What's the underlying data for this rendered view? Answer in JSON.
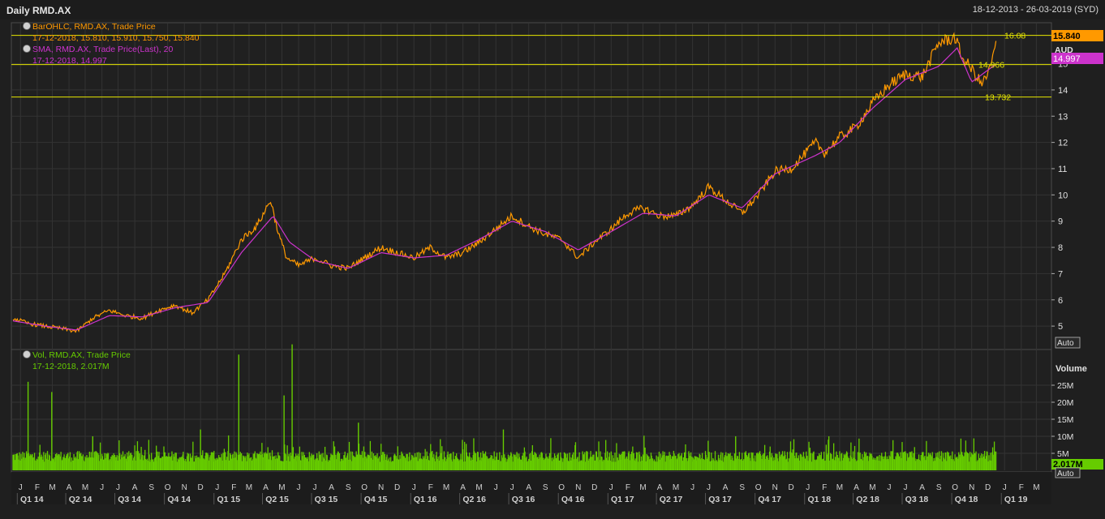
{
  "header": {
    "title": "Daily RMD.AX",
    "range": "18-12-2013 - 26-03-2019 (SYD)"
  },
  "legend": {
    "ohlc_label": "BarOHLC, RMD.AX, Trade Price",
    "ohlc_values": "17-12-2018, 15.810, 15.910, 15.750, 15.840",
    "sma_label": "SMA, RMD.AX, Trade Price(Last), 20",
    "sma_values": "17-12-2018, 14.997",
    "vol_label": "Vol, RMD.AX, Trade Price",
    "vol_values": "17-12-2018, 2.017M"
  },
  "price_axis": {
    "currency": "AUD",
    "auto": "Auto",
    "last_price": "15.840",
    "last_sma": "14.997"
  },
  "volume_axis": {
    "title": "Volume",
    "auto": "Auto",
    "last_volume": "2.017M"
  },
  "hlines": [
    {
      "value": 16.08,
      "label": "16.08"
    },
    {
      "value": 14.966,
      "label": "14.966"
    },
    {
      "value": 13.732,
      "label": "13.732"
    }
  ],
  "colors": {
    "price": "#ff9900",
    "sma": "#cc33cc",
    "volume": "#66cc00",
    "hline": "#e6e600",
    "grid": "#333333"
  },
  "chart_data": [
    {
      "type": "line",
      "ylim": [
        4.2,
        16.5
      ],
      "yticks": [
        5,
        6,
        7,
        8,
        9,
        10,
        11,
        12,
        13,
        14,
        15
      ],
      "series": [
        {
          "name": "BarOHLC, RMD.AX, Trade Price",
          "x": [
            "2013-12-18",
            "2014-01-15",
            "2014-02-15",
            "2014-03-20",
            "2014-04-15",
            "2014-05-15",
            "2014-06-15",
            "2014-07-15",
            "2014-08-15",
            "2014-09-15",
            "2014-10-15",
            "2014-11-15",
            "2014-12-15",
            "2015-01-15",
            "2015-02-15",
            "2015-03-15",
            "2015-04-10",
            "2015-04-25",
            "2015-05-10",
            "2015-06-01",
            "2015-07-01",
            "2015-08-01",
            "2015-09-01",
            "2015-10-01",
            "2015-11-01",
            "2015-12-01",
            "2016-01-01",
            "2016-02-01",
            "2016-03-01",
            "2016-04-01",
            "2016-05-01",
            "2016-06-01",
            "2016-07-01",
            "2016-08-01",
            "2016-09-01",
            "2016-10-01",
            "2016-11-01",
            "2016-12-01",
            "2017-01-01",
            "2017-02-01",
            "2017-03-01",
            "2017-04-01",
            "2017-05-01",
            "2017-06-01",
            "2017-07-01",
            "2017-08-01",
            "2017-09-01",
            "2017-10-01",
            "2017-11-01",
            "2017-12-01",
            "2018-01-15",
            "2018-02-01",
            "2018-03-01",
            "2018-04-01",
            "2018-05-01",
            "2018-06-01",
            "2018-07-01",
            "2018-08-01",
            "2018-09-01",
            "2018-10-01",
            "2018-10-15",
            "2018-11-01",
            "2018-11-20",
            "2018-12-05",
            "2018-12-17"
          ],
          "values": [
            5.3,
            5.1,
            5.0,
            4.9,
            4.8,
            5.3,
            5.6,
            5.4,
            5.3,
            5.6,
            5.8,
            5.5,
            6.0,
            7.0,
            8.3,
            8.8,
            9.8,
            8.5,
            7.6,
            7.3,
            7.6,
            7.3,
            7.2,
            7.6,
            8.0,
            7.8,
            7.6,
            8.0,
            7.6,
            7.8,
            8.2,
            8.7,
            9.2,
            8.8,
            8.5,
            8.3,
            7.6,
            8.2,
            8.7,
            9.3,
            9.5,
            9.2,
            9.2,
            9.6,
            10.3,
            9.8,
            9.3,
            10.0,
            10.9,
            11.0,
            12.0,
            11.6,
            12.2,
            12.6,
            13.5,
            14.2,
            14.6,
            14.5,
            15.8,
            16.0,
            15.2,
            14.8,
            14.2,
            14.8,
            15.84
          ]
        },
        {
          "name": "SMA, RMD.AX, Trade Price(Last), 20",
          "x": [
            "2013-12-18",
            "2014-02-15",
            "2014-04-15",
            "2014-06-15",
            "2014-08-15",
            "2014-10-15",
            "2014-12-15",
            "2015-02-15",
            "2015-04-15",
            "2015-05-15",
            "2015-07-01",
            "2015-09-01",
            "2015-11-01",
            "2016-01-01",
            "2016-03-01",
            "2016-05-01",
            "2016-07-01",
            "2016-09-01",
            "2016-11-01",
            "2017-01-01",
            "2017-03-01",
            "2017-05-01",
            "2017-07-01",
            "2017-09-01",
            "2017-11-01",
            "2018-01-15",
            "2018-03-01",
            "2018-05-01",
            "2018-07-01",
            "2018-09-01",
            "2018-10-05",
            "2018-11-01",
            "2018-12-17"
          ],
          "values": [
            5.2,
            5.0,
            4.85,
            5.4,
            5.35,
            5.7,
            5.9,
            7.8,
            9.2,
            8.2,
            7.5,
            7.2,
            7.8,
            7.6,
            7.7,
            8.3,
            9.0,
            8.6,
            7.9,
            8.6,
            9.3,
            9.2,
            10.0,
            9.5,
            10.8,
            11.5,
            12.0,
            13.3,
            14.4,
            14.9,
            15.6,
            14.3,
            14.997
          ]
        }
      ]
    },
    {
      "type": "bar",
      "ylim": [
        0,
        35
      ],
      "yticks": [
        5,
        10,
        15,
        20,
        25
      ],
      "ytick_labels": [
        "5M",
        "10M",
        "15M",
        "20M",
        "25M"
      ],
      "spikes": [
        {
          "x": "2014-01-15",
          "value": 26
        },
        {
          "x": "2014-02-28",
          "value": 23
        },
        {
          "x": "2014-05-15",
          "value": 10
        },
        {
          "x": "2014-12-01",
          "value": 12
        },
        {
          "x": "2015-02-10",
          "value": 34
        },
        {
          "x": "2015-05-20",
          "value": 37
        },
        {
          "x": "2015-05-05",
          "value": 22
        },
        {
          "x": "2015-09-20",
          "value": 14
        },
        {
          "x": "2016-06-15",
          "value": 12
        },
        {
          "x": "2017-08-20",
          "value": 10
        },
        {
          "x": "2018-02-08",
          "value": 9
        }
      ],
      "last": {
        "x": "2018-12-17",
        "value": 2.017
      }
    }
  ],
  "time_axis": {
    "months": [
      {
        "x": "2014-01-01",
        "label": "J"
      },
      {
        "x": "2014-02-01",
        "label": "F"
      },
      {
        "x": "2014-03-01",
        "label": "M"
      },
      {
        "x": "2014-04-01",
        "label": "A"
      },
      {
        "x": "2014-05-01",
        "label": "M"
      },
      {
        "x": "2014-06-01",
        "label": "J"
      },
      {
        "x": "2014-07-01",
        "label": "J"
      },
      {
        "x": "2014-08-01",
        "label": "A"
      },
      {
        "x": "2014-09-01",
        "label": "S"
      },
      {
        "x": "2014-10-01",
        "label": "O"
      },
      {
        "x": "2014-11-01",
        "label": "N"
      },
      {
        "x": "2014-12-01",
        "label": "D"
      },
      {
        "x": "2015-01-01",
        "label": "J"
      },
      {
        "x": "2015-02-01",
        "label": "F"
      },
      {
        "x": "2015-03-01",
        "label": "M"
      },
      {
        "x": "2015-04-01",
        "label": "A"
      },
      {
        "x": "2015-05-01",
        "label": "M"
      },
      {
        "x": "2015-06-01",
        "label": "J"
      },
      {
        "x": "2015-07-01",
        "label": "J"
      },
      {
        "x": "2015-08-01",
        "label": "A"
      },
      {
        "x": "2015-09-01",
        "label": "S"
      },
      {
        "x": "2015-10-01",
        "label": "O"
      },
      {
        "x": "2015-11-01",
        "label": "N"
      },
      {
        "x": "2015-12-01",
        "label": "D"
      },
      {
        "x": "2016-01-01",
        "label": "J"
      },
      {
        "x": "2016-02-01",
        "label": "F"
      },
      {
        "x": "2016-03-01",
        "label": "M"
      },
      {
        "x": "2016-04-01",
        "label": "A"
      },
      {
        "x": "2016-05-01",
        "label": "M"
      },
      {
        "x": "2016-06-01",
        "label": "J"
      },
      {
        "x": "2016-07-01",
        "label": "J"
      },
      {
        "x": "2016-08-01",
        "label": "A"
      },
      {
        "x": "2016-09-01",
        "label": "S"
      },
      {
        "x": "2016-10-01",
        "label": "O"
      },
      {
        "x": "2016-11-01",
        "label": "N"
      },
      {
        "x": "2016-12-01",
        "label": "D"
      },
      {
        "x": "2017-01-01",
        "label": "J"
      },
      {
        "x": "2017-02-01",
        "label": "F"
      },
      {
        "x": "2017-03-01",
        "label": "M"
      },
      {
        "x": "2017-04-01",
        "label": "A"
      },
      {
        "x": "2017-05-01",
        "label": "M"
      },
      {
        "x": "2017-06-01",
        "label": "J"
      },
      {
        "x": "2017-07-01",
        "label": "J"
      },
      {
        "x": "2017-08-01",
        "label": "A"
      },
      {
        "x": "2017-09-01",
        "label": "S"
      },
      {
        "x": "2017-10-01",
        "label": "O"
      },
      {
        "x": "2017-11-01",
        "label": "N"
      },
      {
        "x": "2017-12-01",
        "label": "D"
      },
      {
        "x": "2018-01-01",
        "label": "J"
      },
      {
        "x": "2018-02-01",
        "label": "F"
      },
      {
        "x": "2018-03-01",
        "label": "M"
      },
      {
        "x": "2018-04-01",
        "label": "A"
      },
      {
        "x": "2018-05-01",
        "label": "M"
      },
      {
        "x": "2018-06-01",
        "label": "J"
      },
      {
        "x": "2018-07-01",
        "label": "J"
      },
      {
        "x": "2018-08-01",
        "label": "A"
      },
      {
        "x": "2018-09-01",
        "label": "S"
      },
      {
        "x": "2018-10-01",
        "label": "O"
      },
      {
        "x": "2018-11-01",
        "label": "N"
      },
      {
        "x": "2018-12-01",
        "label": "D"
      },
      {
        "x": "2019-01-01",
        "label": "J"
      },
      {
        "x": "2019-02-01",
        "label": "F"
      },
      {
        "x": "2019-03-01",
        "label": "M"
      }
    ],
    "quarters": [
      {
        "x": "2014-01-01",
        "label": "Q1 14"
      },
      {
        "x": "2014-04-01",
        "label": "Q2 14"
      },
      {
        "x": "2014-07-01",
        "label": "Q3 14"
      },
      {
        "x": "2014-10-01",
        "label": "Q4 14"
      },
      {
        "x": "2015-01-01",
        "label": "Q1 15"
      },
      {
        "x": "2015-04-01",
        "label": "Q2 15"
      },
      {
        "x": "2015-07-01",
        "label": "Q3 15"
      },
      {
        "x": "2015-10-01",
        "label": "Q4 15"
      },
      {
        "x": "2016-01-01",
        "label": "Q1 16"
      },
      {
        "x": "2016-04-01",
        "label": "Q2 16"
      },
      {
        "x": "2016-07-01",
        "label": "Q3 16"
      },
      {
        "x": "2016-10-01",
        "label": "Q4 16"
      },
      {
        "x": "2017-01-01",
        "label": "Q1 17"
      },
      {
        "x": "2017-04-01",
        "label": "Q2 17"
      },
      {
        "x": "2017-07-01",
        "label": "Q3 17"
      },
      {
        "x": "2017-10-01",
        "label": "Q4 17"
      },
      {
        "x": "2018-01-01",
        "label": "Q1 18"
      },
      {
        "x": "2018-04-01",
        "label": "Q2 18"
      },
      {
        "x": "2018-07-01",
        "label": "Q3 18"
      },
      {
        "x": "2018-10-01",
        "label": "Q4 18"
      },
      {
        "x": "2019-01-01",
        "label": "Q1 19"
      }
    ]
  }
}
